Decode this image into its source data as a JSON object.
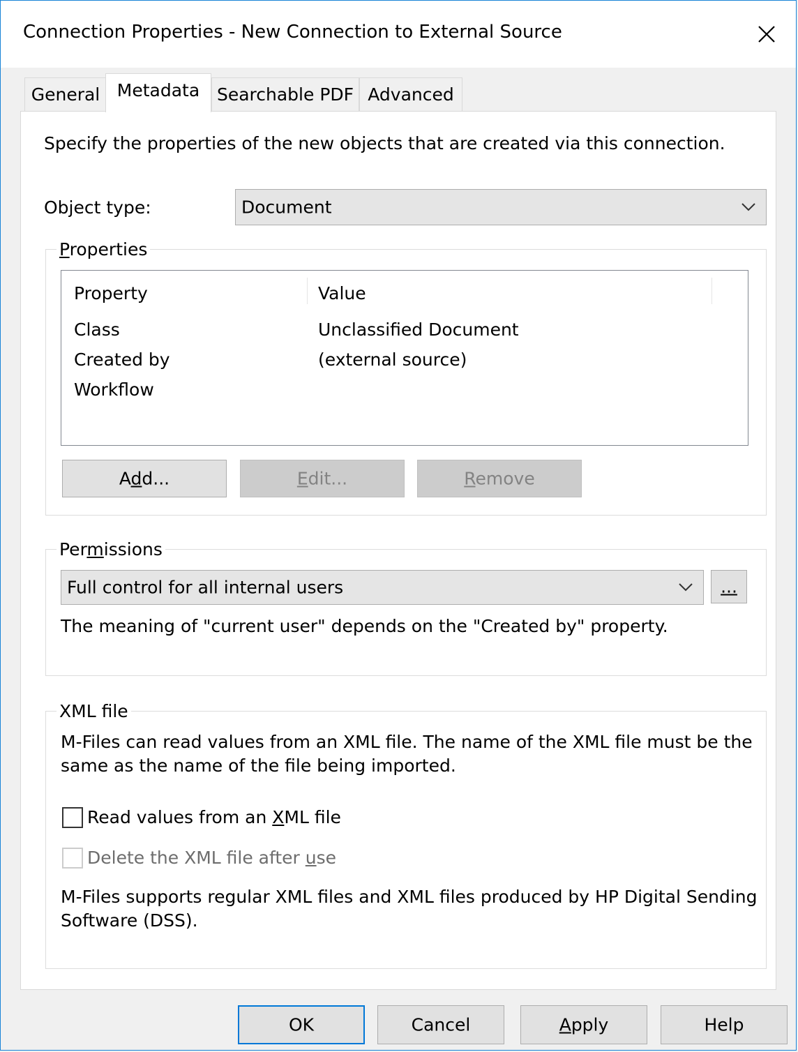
{
  "window": {
    "title": "Connection Properties - New Connection to External Source"
  },
  "tabs": [
    {
      "label": "General",
      "active": false
    },
    {
      "label": "Metadata",
      "active": true
    },
    {
      "label": "Searchable PDF",
      "active": false
    },
    {
      "label": "Advanced",
      "active": false
    }
  ],
  "metadata": {
    "intro": "Specify the properties of the new objects that are created via this connection.",
    "object_type_label": "Object type:",
    "object_type_value": "Document",
    "properties_group": "Properties",
    "columns": [
      "Property",
      "Value"
    ],
    "rows": [
      {
        "property": "Class",
        "value": "Unclassified Document"
      },
      {
        "property": "Created by",
        "value": "(external source)"
      },
      {
        "property": "Workflow",
        "value": ""
      }
    ],
    "add_label": "Add...",
    "edit_label": "Edit...",
    "remove_label": "Remove",
    "permissions_group": "Permissions",
    "permissions_value": "Full control for all internal users",
    "permissions_more": "...",
    "permissions_note": "The meaning of \"current user\" depends on the \"Created by\" property.",
    "xml_group": "XML file",
    "xml_intro_line1": "M-Files can read values from an XML file. The name of the XML file must be the",
    "xml_intro_line2": "same as the name of the file being imported.",
    "read_xml_label": "Read values from an XML file",
    "read_xml_checked": false,
    "delete_xml_label": "Delete the XML file after use",
    "delete_xml_checked": false,
    "xml_note_line1": "M-Files supports regular XML files and XML files produced by HP Digital Sending",
    "xml_note_line2": "Software (DSS)."
  },
  "footer": {
    "ok": "OK",
    "cancel": "Cancel",
    "apply": "Apply",
    "help": "Help"
  },
  "colors": {
    "accent": "#0078d7",
    "window_border": "#1883d7",
    "dialog_bg": "#f0f0f0"
  }
}
